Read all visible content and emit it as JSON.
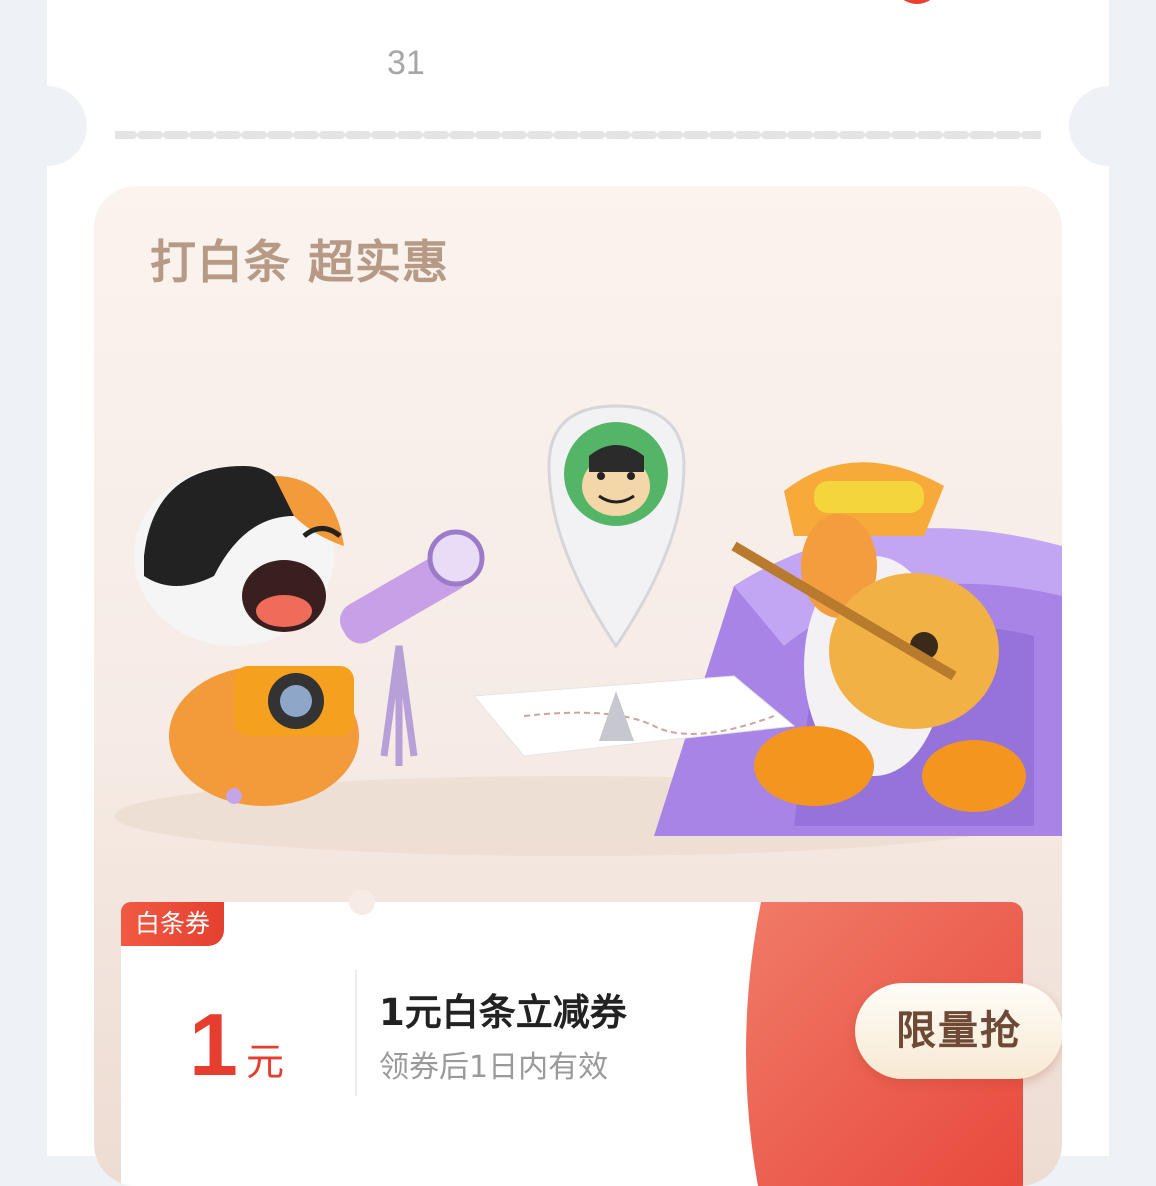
{
  "top": {
    "date_number": "31"
  },
  "promo": {
    "title": "打白条 超实惠",
    "scene_alt": "",
    "coupon": {
      "tag": "白条券",
      "amount": "1",
      "unit": "元",
      "title": "1元白条立减券",
      "subtitle": "领券后1日内有效",
      "button": "限量抢"
    }
  },
  "colors": {
    "accent_red": "#e53d30",
    "title_brown": "#b69a86",
    "button_text": "#6e4a36"
  }
}
